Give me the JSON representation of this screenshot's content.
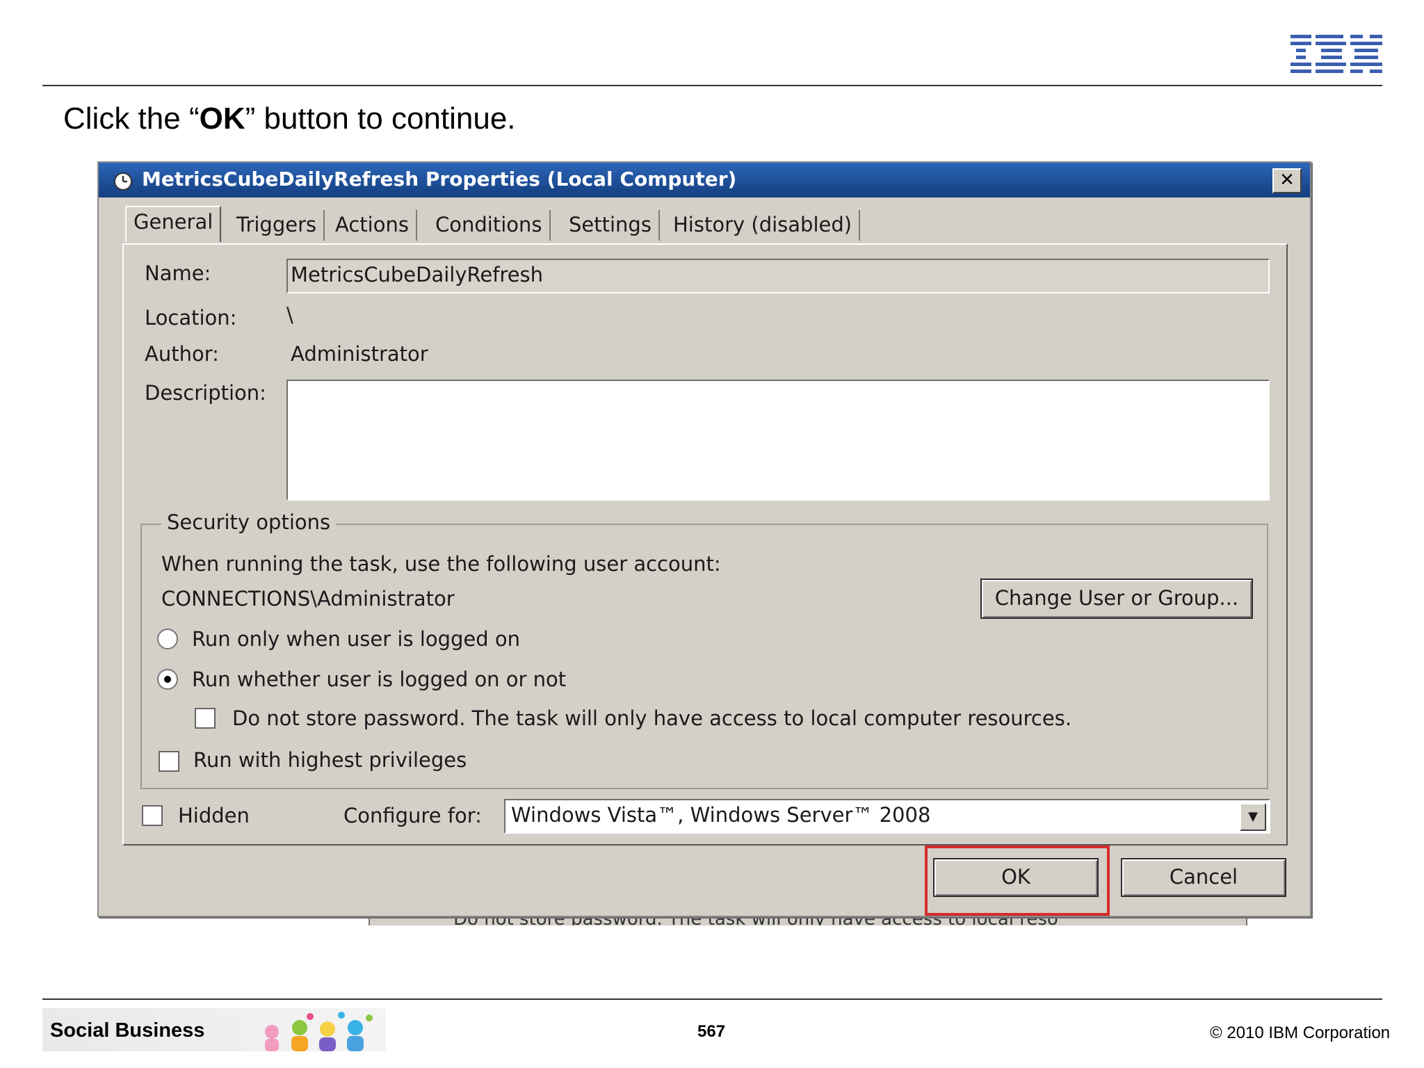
{
  "slide": {
    "instruction_pre": "Click the “",
    "instruction_bold": "OK",
    "instruction_post": "” button to continue.",
    "logo_text": "IBM"
  },
  "dialog": {
    "title": "MetricsCubeDailyRefresh Properties (Local Computer)",
    "close_label": "✕",
    "tabs": [
      {
        "label": "General",
        "active": true
      },
      {
        "label": "Triggers"
      },
      {
        "label": "Actions"
      },
      {
        "label": "Conditions"
      },
      {
        "label": "Settings"
      },
      {
        "label": "History (disabled)"
      }
    ],
    "fields": {
      "name_label": "Name:",
      "name_value": "MetricsCubeDailyRefresh",
      "location_label": "Location:",
      "location_value": "\\",
      "author_label": "Author:",
      "author_value": "Administrator",
      "description_label": "Description:",
      "description_value": ""
    },
    "security": {
      "group_title": "Security options",
      "account_prompt": "When running the task, use the following user account:",
      "account": "CONNECTIONS\\Administrator",
      "change_button": "Change User or Group...",
      "radio_logged_on": "Run only when user is logged on",
      "radio_whether": "Run whether user is logged on or not",
      "selected_radio": "radio_whether",
      "no_store_password": "Do not store password.  The task will only have access to local computer resources.",
      "highest_privileges": "Run with highest privileges"
    },
    "hidden_label": "Hidden",
    "configure_label": "Configure for:",
    "configure_value": "Windows Vista™, Windows Server™ 2008",
    "ok_label": "OK",
    "cancel_label": "Cancel",
    "highlight_color": "#d62b2b"
  },
  "background_window": {
    "partial_text": "Do not store password.  The task will only have access to local reso"
  },
  "footer": {
    "brand": "Social Business",
    "page_number": "567",
    "copyright": "© 2010 IBM Corporation"
  }
}
